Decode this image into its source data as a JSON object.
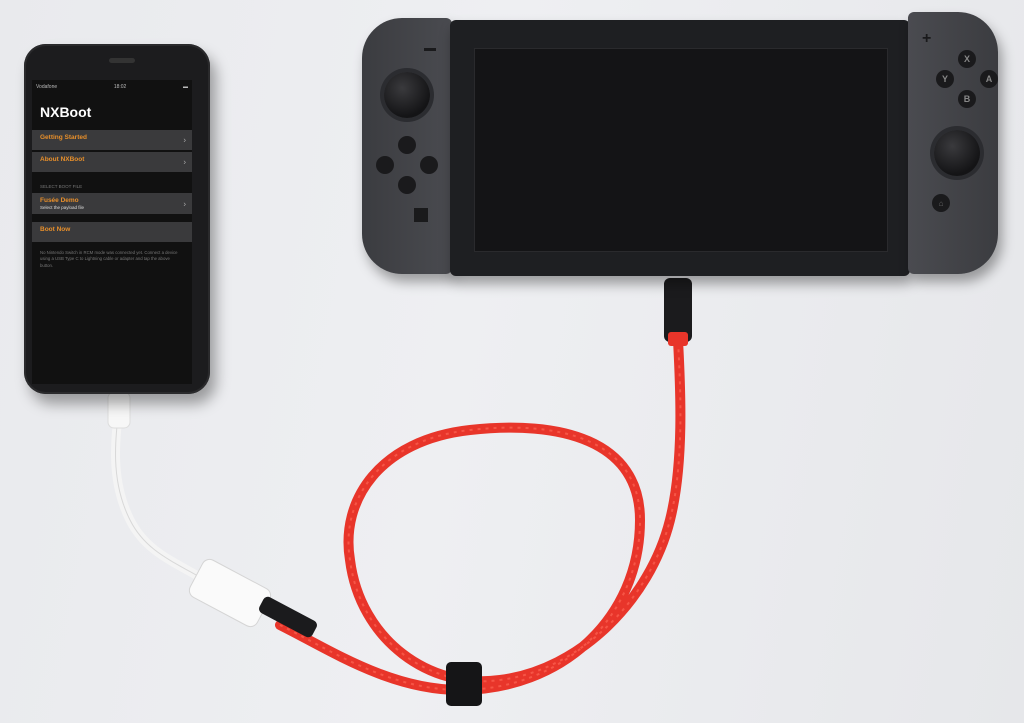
{
  "phone": {
    "status": {
      "carrier": "Vodafone",
      "time": "18:02"
    },
    "app_title": "NXBoot",
    "rows_top": [
      {
        "label": "Getting Started"
      },
      {
        "label": "About NXBoot"
      }
    ],
    "section_label": "SELECT BOOT FILE",
    "payload_row": {
      "label": "Fusée Demo",
      "sub": "Select the payload file"
    },
    "boot_row": {
      "label": "Boot Now"
    },
    "footer_text": "No Nintendo Switch in RCM mode was connected yet. Connect a device using a USB Type C to Lightning cable or adapter and tap the above button."
  },
  "switch": {
    "buttons": {
      "x": "X",
      "y": "Y",
      "a": "A",
      "b": "B"
    }
  },
  "colors": {
    "accent": "#e88f2a",
    "cable_red": "#e8352a",
    "background": "#eceef1"
  }
}
